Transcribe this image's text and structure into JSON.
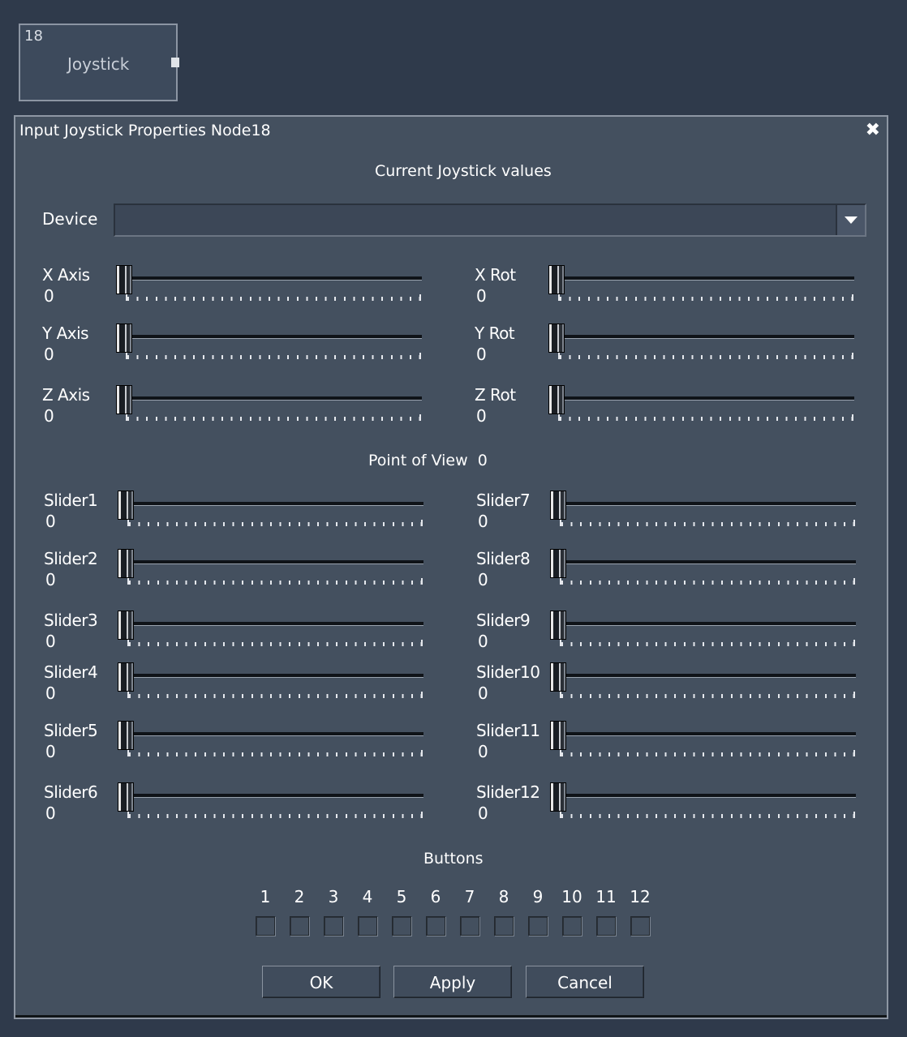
{
  "node": {
    "number": "18",
    "label": "Joystick"
  },
  "dialog": {
    "title": "Input Joystick Properties Node18",
    "close_glyph": "✖",
    "heading": "Current Joystick values",
    "device_label": "Device",
    "device_value": "",
    "axes_left": [
      {
        "name": "X Axis",
        "value": "0",
        "level": 0
      },
      {
        "name": "Y Axis",
        "value": "0",
        "level": 0
      },
      {
        "name": "Z Axis",
        "value": "0",
        "level": 0
      }
    ],
    "axes_right": [
      {
        "name": "X Rot",
        "value": "0",
        "level": 0
      },
      {
        "name": "Y Rot",
        "value": "0",
        "level": 0
      },
      {
        "name": "Z Rot",
        "value": "0",
        "level": 0
      }
    ],
    "pov_label": "Point of View",
    "pov_value": "0",
    "sliders_left": [
      {
        "name": "Slider1",
        "value": "0",
        "level": 0
      },
      {
        "name": "Slider2",
        "value": "0",
        "level": 0
      },
      {
        "name": "Slider3",
        "value": "0",
        "level": 0
      },
      {
        "name": "Slider4",
        "value": "0",
        "level": 0
      },
      {
        "name": "Slider5",
        "value": "0",
        "level": 0
      },
      {
        "name": "Slider6",
        "value": "0",
        "level": 0
      }
    ],
    "sliders_right": [
      {
        "name": "Slider7",
        "value": "0",
        "level": 0
      },
      {
        "name": "Slider8",
        "value": "0",
        "level": 0
      },
      {
        "name": "Slider9",
        "value": "0",
        "level": 0
      },
      {
        "name": "Slider10",
        "value": "0",
        "level": 0
      },
      {
        "name": "Slider11",
        "value": "0",
        "level": 0
      },
      {
        "name": "Slider12",
        "value": "0",
        "level": 0
      }
    ],
    "buttons_label": "Buttons",
    "buttons": [
      "1",
      "2",
      "3",
      "4",
      "5",
      "6",
      "7",
      "8",
      "9",
      "10",
      "11",
      "12"
    ],
    "ok_label": "OK",
    "apply_label": "Apply",
    "cancel_label": "Cancel"
  }
}
